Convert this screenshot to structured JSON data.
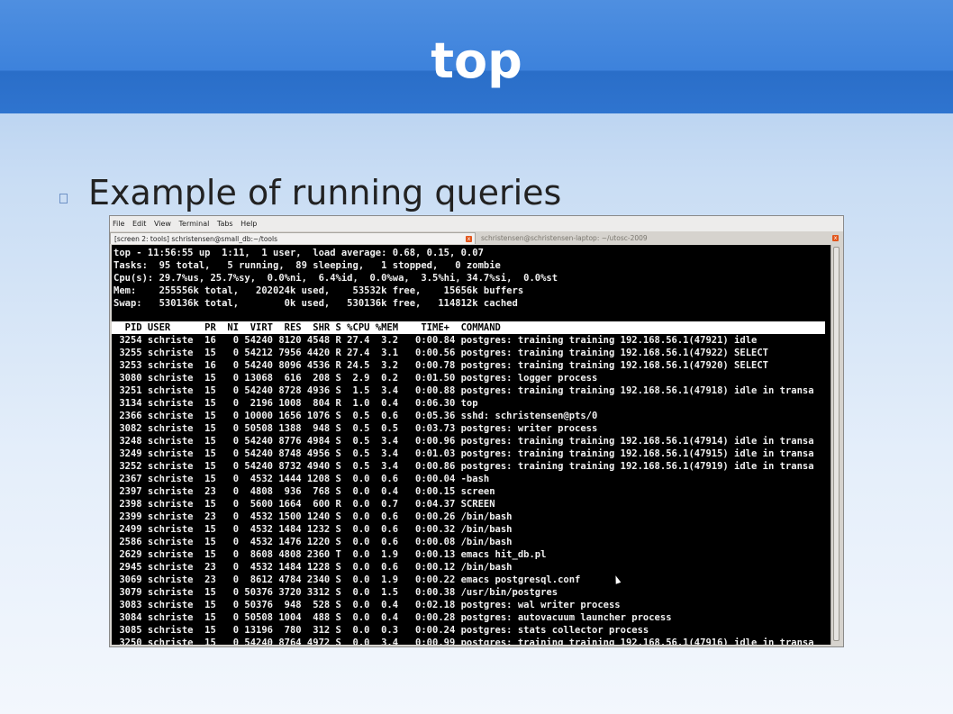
{
  "slide": {
    "title": "top",
    "bullet": "Example of running queries"
  },
  "window": {
    "menu": [
      "File",
      "Edit",
      "View",
      "Terminal",
      "Tabs",
      "Help"
    ],
    "tabs": [
      {
        "label": "[screen 2: tools] schristensen@small_db:~/tools",
        "active": true
      },
      {
        "label": "schristensen@schristensen-laptop: ~/utosc-2009",
        "active": false
      }
    ],
    "tab_close_glyph": "x"
  },
  "terminal": {
    "summary": [
      "top - 11:56:55 up  1:11,  1 user,  load average: 0.68, 0.15, 0.07",
      "Tasks:  95 total,   5 running,  89 sleeping,   1 stopped,   0 zombie",
      "Cpu(s): 29.7%us, 25.7%sy,  0.0%ni,  6.4%id,  0.0%wa,  3.5%hi, 34.7%si,  0.0%st",
      "Mem:    255556k total,   202024k used,    53532k free,    15656k buffers",
      "Swap:   530136k total,        0k used,   530136k free,   114812k cached"
    ],
    "columns": "  PID USER      PR  NI  VIRT  RES  SHR S %CPU %MEM    TIME+  COMMAND",
    "rows": [
      " 3254 schriste  16   0 54240 8120 4548 R 27.4  3.2   0:00.84 postgres: training training 192.168.56.1(47921) idle",
      " 3255 schriste  15   0 54212 7956 4420 R 27.4  3.1   0:00.56 postgres: training training 192.168.56.1(47922) SELECT",
      " 3253 schriste  16   0 54240 8096 4536 R 24.5  3.2   0:00.78 postgres: training training 192.168.56.1(47920) SELECT",
      " 3080 schriste  15   0 13068  616  208 S  2.9  0.2   0:01.50 postgres: logger process",
      " 3251 schriste  15   0 54240 8728 4936 S  1.5  3.4   0:00.88 postgres: training training 192.168.56.1(47918) idle in transa",
      " 3134 schriste  15   0  2196 1008  804 R  1.0  0.4   0:06.30 top",
      " 2366 schriste  15   0 10000 1656 1076 S  0.5  0.6   0:05.36 sshd: schristensen@pts/0",
      " 3082 schriste  15   0 50508 1388  948 S  0.5  0.5   0:03.73 postgres: writer process",
      " 3248 schriste  15   0 54240 8776 4984 S  0.5  3.4   0:00.96 postgres: training training 192.168.56.1(47914) idle in transa",
      " 3249 schriste  15   0 54240 8748 4956 S  0.5  3.4   0:01.03 postgres: training training 192.168.56.1(47915) idle in transa",
      " 3252 schriste  15   0 54240 8732 4940 S  0.5  3.4   0:00.86 postgres: training training 192.168.56.1(47919) idle in transa",
      " 2367 schriste  15   0  4532 1444 1208 S  0.0  0.6   0:00.04 -bash",
      " 2397 schriste  23   0  4808  936  768 S  0.0  0.4   0:00.15 screen",
      " 2398 schriste  15   0  5600 1664  600 R  0.0  0.7   0:04.37 SCREEN",
      " 2399 schriste  23   0  4532 1500 1240 S  0.0  0.6   0:00.26 /bin/bash",
      " 2499 schriste  15   0  4532 1484 1232 S  0.0  0.6   0:00.32 /bin/bash",
      " 2586 schriste  15   0  4532 1476 1220 S  0.0  0.6   0:00.08 /bin/bash",
      " 2629 schriste  15   0  8608 4808 2360 T  0.0  1.9   0:00.13 emacs hit_db.pl",
      " 2945 schriste  23   0  4532 1484 1228 S  0.0  0.6   0:00.12 /bin/bash",
      " 3069 schriste  23   0  8612 4784 2340 S  0.0  1.9   0:00.22 emacs postgresql.conf",
      " 3079 schriste  15   0 50376 3720 3312 S  0.0  1.5   0:00.38 /usr/bin/postgres",
      " 3083 schriste  15   0 50376  948  528 S  0.0  0.4   0:02.18 postgres: wal writer process",
      " 3084 schriste  15   0 50508 1004  488 S  0.0  0.4   0:00.28 postgres: autovacuum launcher process",
      " 3085 schriste  15   0 13196  780  312 S  0.0  0.3   0:00.24 postgres: stats collector process",
      " 3250 schriste  15   0 54240 8764 4972 S  0.0  3.4   0:00.99 postgres: training training 192.168.56.1(47916) idle in transa"
    ]
  }
}
